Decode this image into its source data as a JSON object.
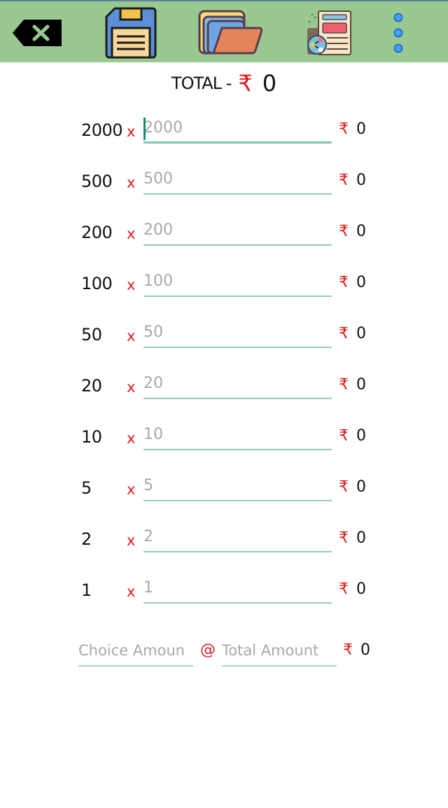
{
  "toolbar": {
    "background_color": "#99c991",
    "buttons": [
      {
        "id": "clear",
        "icon": "backspace-clear-icon"
      },
      {
        "id": "save",
        "icon": "floppy-disk-save-icon"
      },
      {
        "id": "open",
        "icon": "folder-open-icon"
      },
      {
        "id": "share",
        "icon": "share-document-icon"
      },
      {
        "id": "more",
        "icon": "more-vertical-icon"
      }
    ]
  },
  "total": {
    "label": "TOTAL -",
    "currency": "₹",
    "value": "0"
  },
  "multiply_symbol": "x",
  "currency_symbol": "₹",
  "rows": [
    {
      "denomination": "2000",
      "placeholder": "2000",
      "value": "",
      "amount": "0",
      "focused": true
    },
    {
      "denomination": "500",
      "placeholder": "500",
      "value": "",
      "amount": "0"
    },
    {
      "denomination": "200",
      "placeholder": "200",
      "value": "",
      "amount": "0"
    },
    {
      "denomination": "100",
      "placeholder": "100",
      "value": "",
      "amount": "0"
    },
    {
      "denomination": "50",
      "placeholder": "50",
      "value": "",
      "amount": "0"
    },
    {
      "denomination": "20",
      "placeholder": "20",
      "value": "",
      "amount": "0"
    },
    {
      "denomination": "10",
      "placeholder": "10",
      "value": "",
      "amount": "0"
    },
    {
      "denomination": "5",
      "placeholder": "5",
      "value": "",
      "amount": "0"
    },
    {
      "denomination": "2",
      "placeholder": "2",
      "value": "",
      "amount": "0"
    },
    {
      "denomination": "1",
      "placeholder": "1",
      "value": "",
      "amount": "0"
    }
  ],
  "choice": {
    "choice_placeholder": "Choice Amoun",
    "at_symbol": "@",
    "total_placeholder": "Total Amount",
    "currency": "₹",
    "value": "0"
  },
  "colors": {
    "accent_red": "#e01b1b",
    "underline_teal": "#8fcdbd",
    "caret_teal": "#138f7c"
  }
}
